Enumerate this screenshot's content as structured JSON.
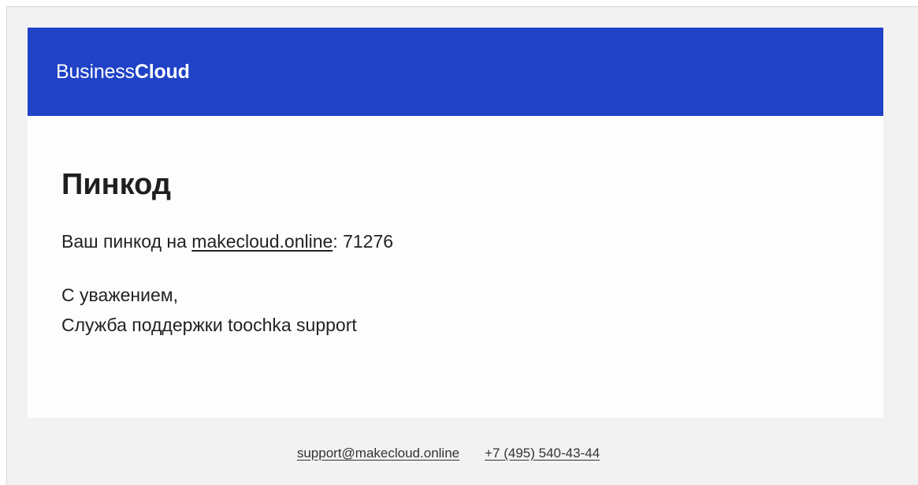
{
  "header": {
    "brand_regular": "Business",
    "brand_bold": "Cloud",
    "background_color": "#1f42c6"
  },
  "content": {
    "title": "Пинкод",
    "message_prefix": "Ваш пинкод на ",
    "site_link": "makecloud.online",
    "message_separator": ": ",
    "pincode": "71276",
    "greeting": "С уважением,",
    "signature": "Служба поддержки toochka support"
  },
  "footer": {
    "email": "support@makecloud.online",
    "phone": "+7 (495) 540-43-44"
  }
}
